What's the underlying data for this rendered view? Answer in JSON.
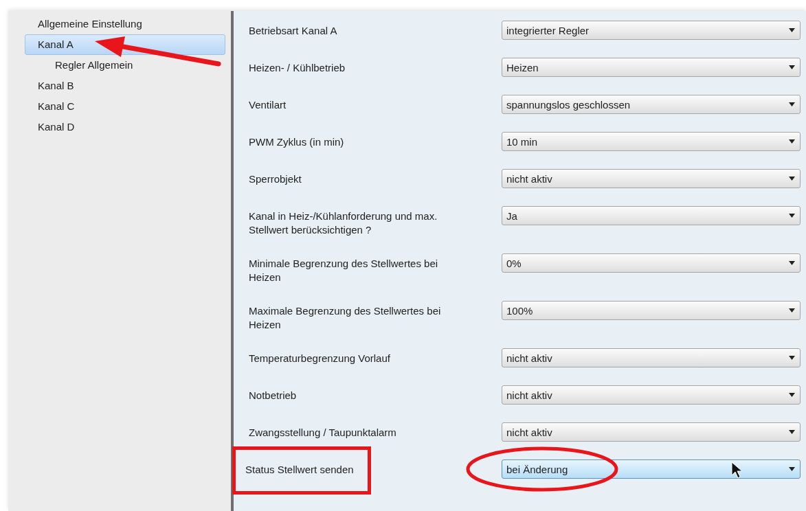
{
  "sidebar": {
    "items": [
      {
        "label": "Allgemeine Einstellung",
        "selected": false
      },
      {
        "label": "Kanal A",
        "selected": true,
        "children": [
          {
            "label": "Regler Allgemein",
            "selected": false
          }
        ]
      },
      {
        "label": "Kanal B",
        "selected": false
      },
      {
        "label": "Kanal C",
        "selected": false
      },
      {
        "label": "Kanal D",
        "selected": false
      }
    ]
  },
  "parameters": [
    {
      "label": "Betriebsart Kanal A",
      "value": "integrierter Regler",
      "hovered": false
    },
    {
      "label": "Heizen- / Kühlbetrieb",
      "value": "Heizen",
      "hovered": false
    },
    {
      "label": "Ventilart",
      "value": "spannungslos geschlossen",
      "hovered": false
    },
    {
      "label": "PWM Zyklus (in min)",
      "value": "10 min",
      "hovered": false
    },
    {
      "label": "Sperrobjekt",
      "value": "nicht aktiv",
      "hovered": false
    },
    {
      "label": "Kanal in Heiz-/Kühlanforderung und max. Stellwert berücksichtigen ?",
      "value": "Ja",
      "hovered": false
    },
    {
      "label": "Minimale Begrenzung des Stellwertes bei Heizen",
      "value": "0%",
      "hovered": false
    },
    {
      "label": "Maximale Begrenzung des Stellwertes bei Heizen",
      "value": "100%",
      "hovered": false
    },
    {
      "label": "Temperaturbegrenzung Vorlauf",
      "value": "nicht aktiv",
      "hovered": false
    },
    {
      "label": "Notbetrieb",
      "value": "nicht aktiv",
      "hovered": false
    },
    {
      "label": "Zwangsstellung / Taupunktalarm",
      "value": "nicht aktiv",
      "hovered": false
    },
    {
      "label": "Status Stellwert senden",
      "value": "bei Änderung",
      "hovered": true
    }
  ]
}
